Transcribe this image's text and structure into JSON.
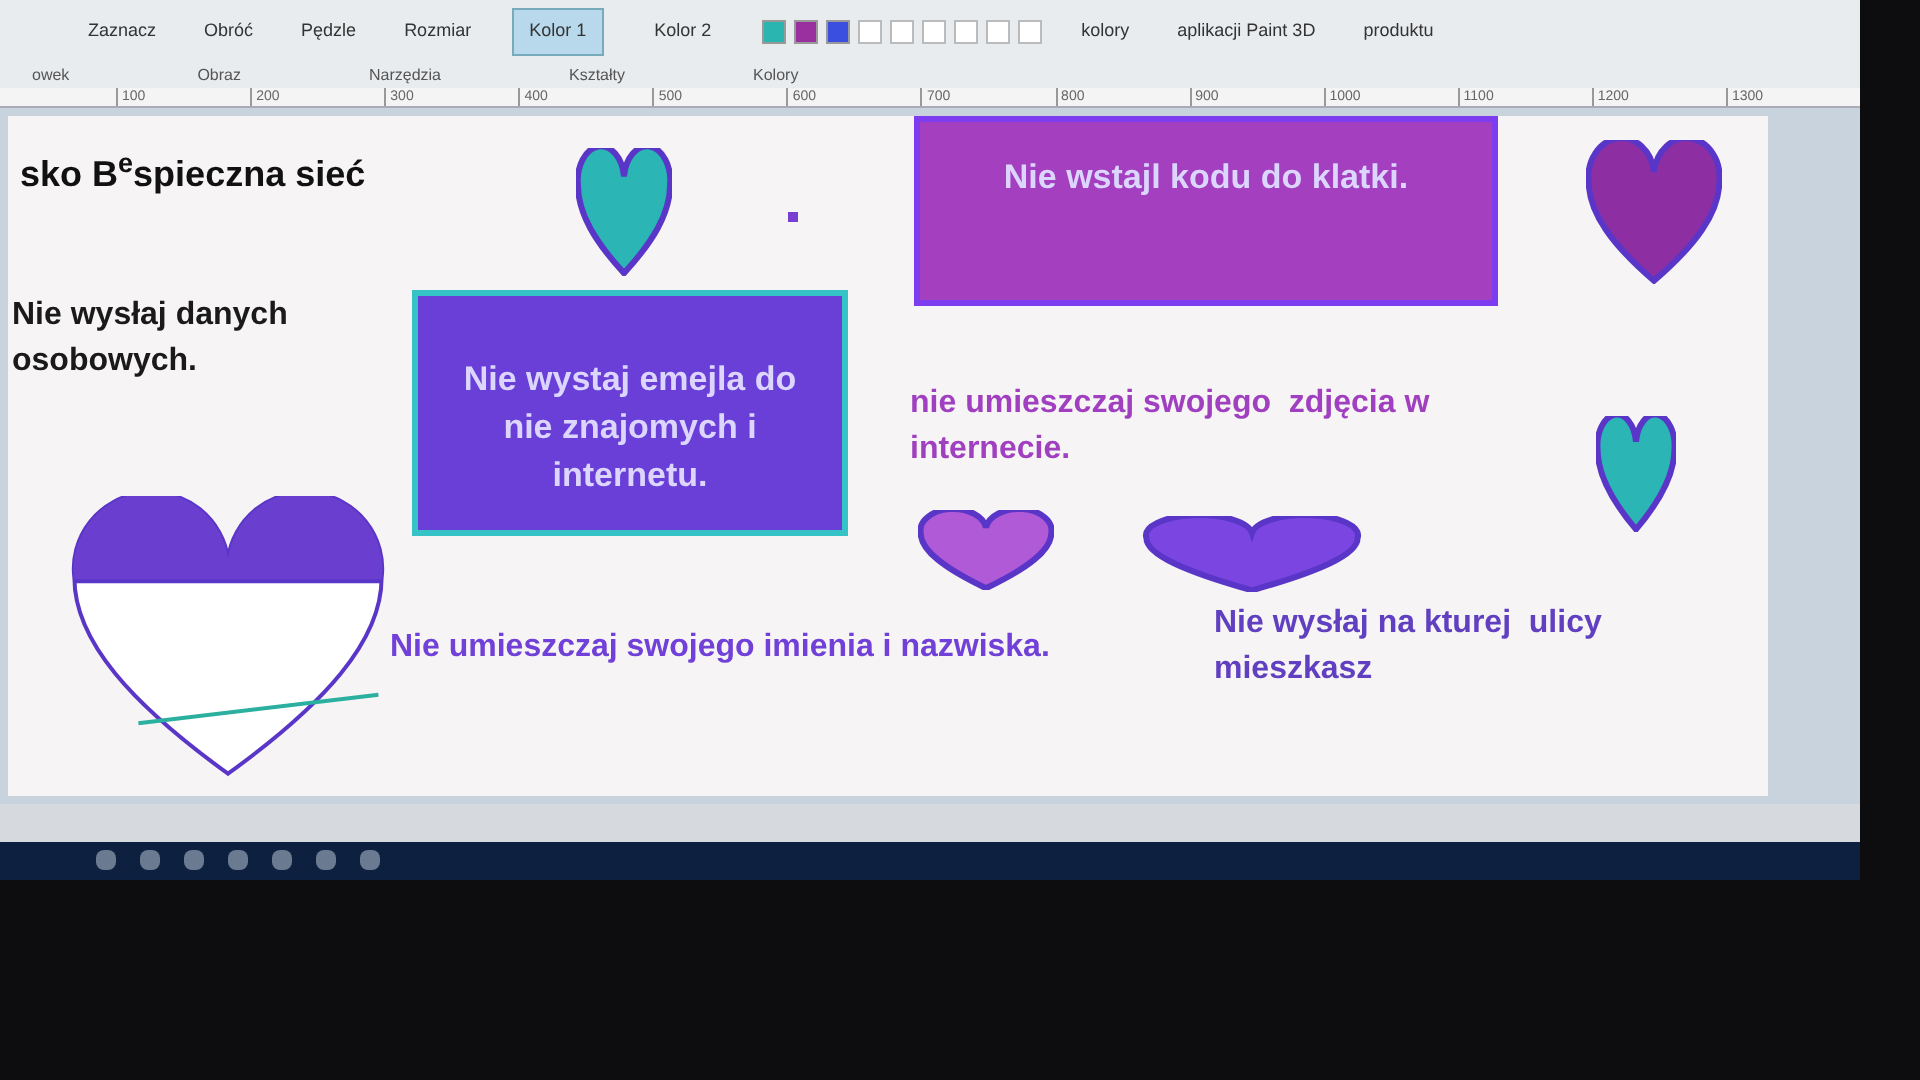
{
  "ribbon": {
    "tools": [
      {
        "label": "Zaznacz"
      },
      {
        "label": "Obróć"
      },
      {
        "label": "Pędzle"
      },
      {
        "label": "Rozmiar"
      }
    ],
    "color_slots": [
      {
        "label": "Kolor 1",
        "selected": true
      },
      {
        "label": "Kolor 2",
        "selected": false
      }
    ],
    "palette": [
      {
        "color": "#2bb5b0"
      },
      {
        "color": "#9a2fa0"
      },
      {
        "color": "#3a4fe0"
      }
    ],
    "links": [
      "kolory",
      "aplikacji Paint 3D",
      "produktu"
    ],
    "groups": [
      "owek",
      "Obraz",
      "Narzędzia",
      "Kształty",
      "Kolory"
    ]
  },
  "ruler": [
    "100",
    "200",
    "300",
    "400",
    "500",
    "600",
    "700",
    "800",
    "900",
    "1000",
    "1100",
    "1200",
    "1300"
  ],
  "canvas": {
    "items": [
      {
        "kind": "title",
        "text": "sko B$^{e}$spieczna sieć"
      },
      {
        "kind": "heart",
        "color": "#2bb5b5"
      },
      {
        "kind": "dot",
        "color": "#7a3fd0"
      },
      {
        "kind": "box",
        "text": "Nie wstajl kodu do klatki.",
        "color": "#a43fc0"
      },
      {
        "kind": "heart",
        "color": "#8d2fa3"
      },
      {
        "kind": "text",
        "text": "Nie wysłaj danych osobowych.",
        "color": "#1a1a1a"
      },
      {
        "kind": "box",
        "text": "Nie wystaj emejla do nie znajomych i internetu.",
        "color": "#6a3fd8"
      },
      {
        "kind": "text",
        "text": "nie umieszczaj swojego  zdjęcia w internecie.",
        "color": "#a040c0"
      },
      {
        "kind": "heart",
        "color": "#2bb5b5"
      },
      {
        "kind": "split-heart",
        "color": "#6a3fd0"
      },
      {
        "kind": "heart",
        "color": "#b05ad8"
      },
      {
        "kind": "heart",
        "color": "#7a45e0"
      },
      {
        "kind": "text",
        "text": "Nie umieszczaj swojego imienia i nazwiska.",
        "color": "#7040d8"
      },
      {
        "kind": "text",
        "text": "Nie wysłaj na kturej  ulicy mieszkasz",
        "color": "#6040c0"
      }
    ]
  }
}
